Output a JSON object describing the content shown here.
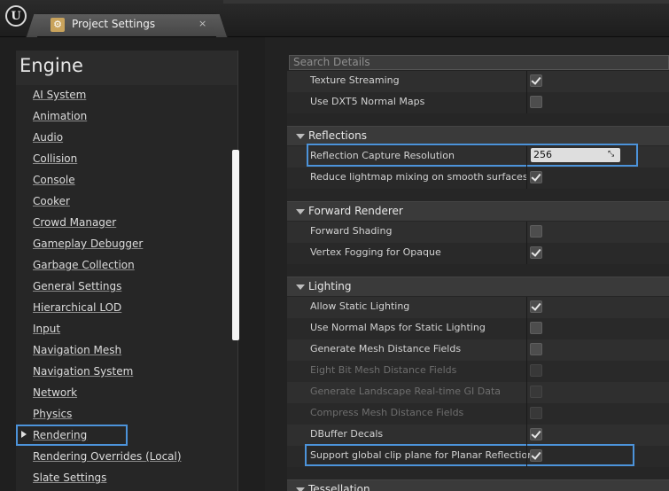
{
  "titlebar": {
    "logo_icon": "unreal-logo-icon",
    "tab_label": "Project Settings",
    "tab_icon": "project-settings-icon",
    "tab_close": "×"
  },
  "sidebar": {
    "header": "Engine",
    "items": [
      {
        "label": "AI System"
      },
      {
        "label": "Animation"
      },
      {
        "label": "Audio"
      },
      {
        "label": "Collision"
      },
      {
        "label": "Console"
      },
      {
        "label": "Cooker"
      },
      {
        "label": "Crowd Manager"
      },
      {
        "label": "Gameplay Debugger"
      },
      {
        "label": "Garbage Collection"
      },
      {
        "label": "General Settings"
      },
      {
        "label": "Hierarchical LOD"
      },
      {
        "label": "Input"
      },
      {
        "label": "Navigation Mesh"
      },
      {
        "label": "Navigation System"
      },
      {
        "label": "Network"
      },
      {
        "label": "Physics"
      },
      {
        "label": "Rendering"
      },
      {
        "label": "Rendering Overrides (Local)"
      },
      {
        "label": "Slate Settings"
      }
    ],
    "selected": "Rendering"
  },
  "search": {
    "placeholder": "Search Details"
  },
  "details": {
    "top_rows": [
      {
        "label": "Texture Streaming",
        "checked": true
      },
      {
        "label": "Use DXT5 Normal Maps",
        "checked": false
      }
    ],
    "reflections": {
      "title": "Reflections",
      "resolution_label": "Reflection Capture Resolution",
      "resolution_value": "256",
      "reduce_label": "Reduce lightmap mixing on smooth surfaces",
      "reduce_checked": true
    },
    "forward": {
      "title": "Forward Renderer",
      "rows": [
        {
          "label": "Forward Shading",
          "checked": false
        },
        {
          "label": "Vertex Fogging for Opaque",
          "checked": true
        }
      ]
    },
    "lighting": {
      "title": "Lighting",
      "rows": [
        {
          "label": "Allow Static Lighting",
          "checked": true,
          "enabled": true
        },
        {
          "label": "Use Normal Maps for Static Lighting",
          "checked": false,
          "enabled": true
        },
        {
          "label": "Generate Mesh Distance Fields",
          "checked": false,
          "enabled": true
        },
        {
          "label": "Eight Bit Mesh Distance Fields",
          "checked": false,
          "enabled": false
        },
        {
          "label": "Generate Landscape Real-time GI Data",
          "checked": false,
          "enabled": false
        },
        {
          "label": "Compress Mesh Distance Fields",
          "checked": false,
          "enabled": false
        },
        {
          "label": "DBuffer Decals",
          "checked": true,
          "enabled": true
        },
        {
          "label": "Support global clip plane for Planar Reflections",
          "checked": true,
          "enabled": true
        }
      ]
    },
    "tessellation": {
      "title": "Tessellation"
    }
  },
  "colors": {
    "highlight": "#4c93da",
    "panel": "#262626",
    "category": "#3a3a3a"
  }
}
